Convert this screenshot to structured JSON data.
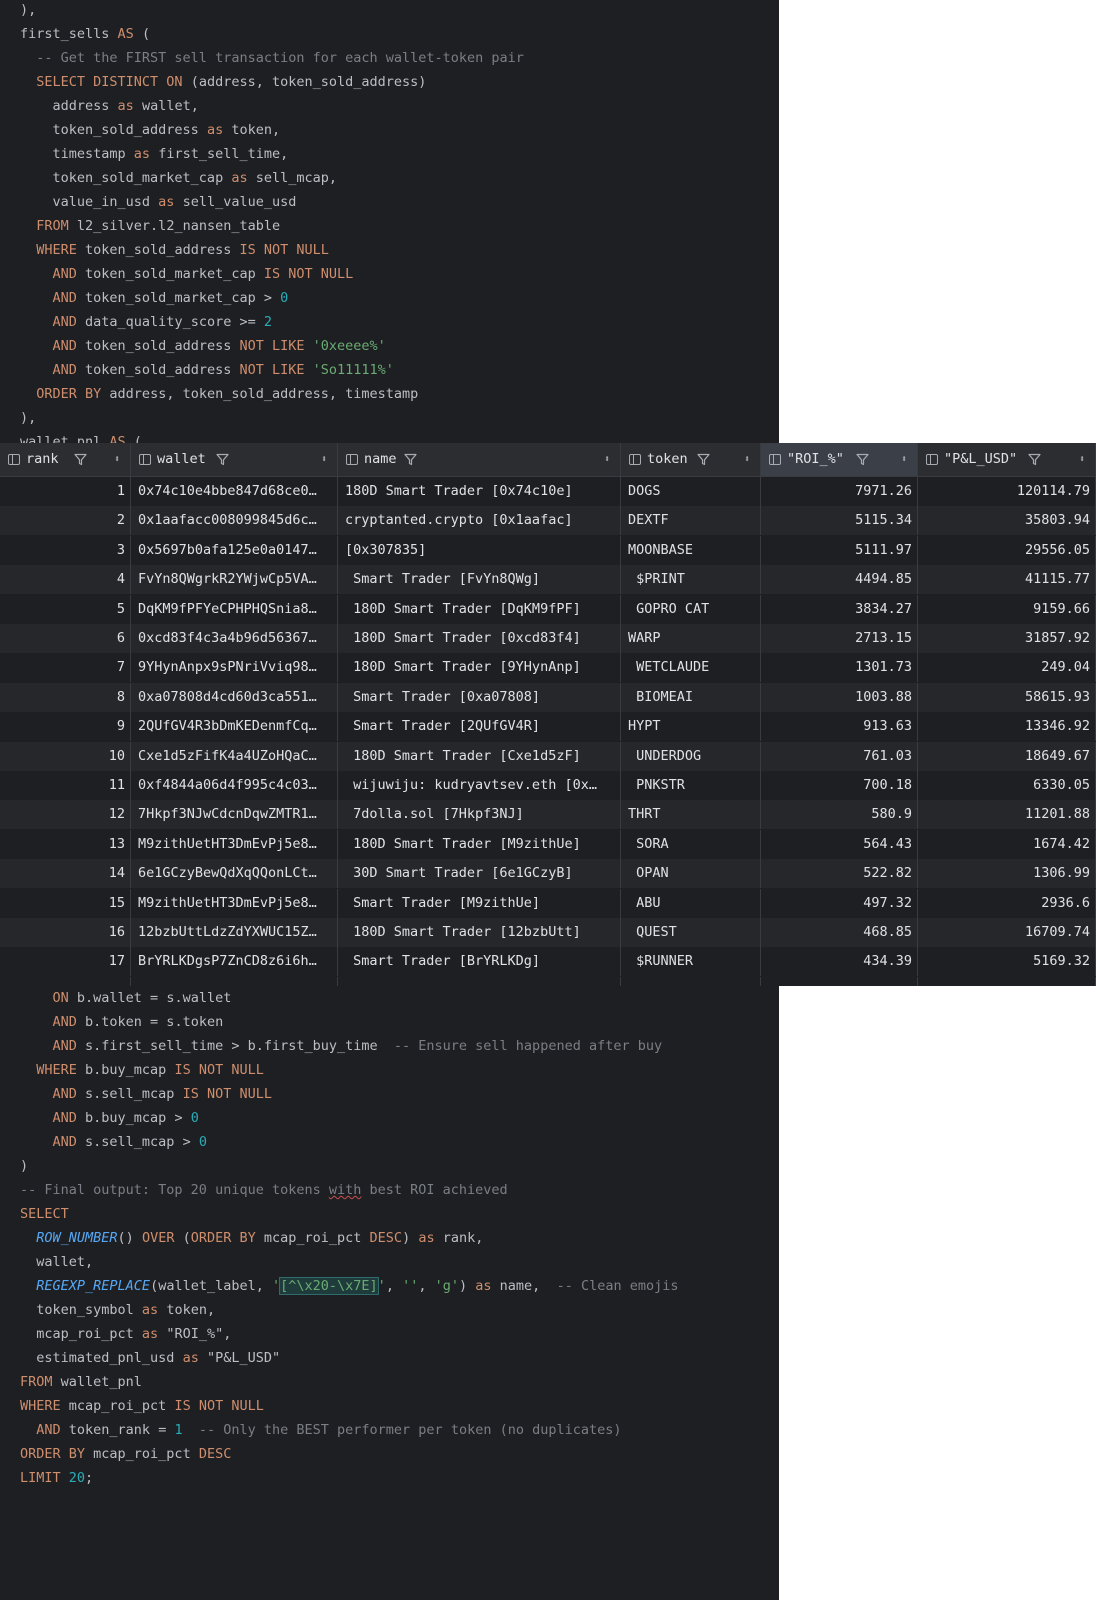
{
  "editor_top": [
    [
      {
        "t": "),",
        "c": ""
      }
    ],
    [
      {
        "t": "first_sells ",
        "c": ""
      },
      {
        "t": "AS",
        "c": "kw"
      },
      {
        "t": " (",
        "c": ""
      }
    ],
    [
      {
        "t": "  -- Get the FIRST sell transaction for each wallet-token pair",
        "c": "cm"
      }
    ],
    [
      {
        "t": "  ",
        "c": ""
      },
      {
        "t": "SELECT DISTINCT ON",
        "c": "kw"
      },
      {
        "t": " (address, token_sold_address)",
        "c": ""
      }
    ],
    [
      {
        "t": "    address ",
        "c": ""
      },
      {
        "t": "as",
        "c": "kw"
      },
      {
        "t": " wallet,",
        "c": ""
      }
    ],
    [
      {
        "t": "    token_sold_address ",
        "c": ""
      },
      {
        "t": "as",
        "c": "kw"
      },
      {
        "t": " token,",
        "c": ""
      }
    ],
    [
      {
        "t": "    timestamp ",
        "c": ""
      },
      {
        "t": "as",
        "c": "kw"
      },
      {
        "t": " first_sell_time,",
        "c": ""
      }
    ],
    [
      {
        "t": "    token_sold_market_cap ",
        "c": ""
      },
      {
        "t": "as",
        "c": "kw"
      },
      {
        "t": " sell_mcap,",
        "c": ""
      }
    ],
    [
      {
        "t": "    value_in_usd ",
        "c": ""
      },
      {
        "t": "as",
        "c": "kw"
      },
      {
        "t": " sell_value_usd",
        "c": ""
      }
    ],
    [
      {
        "t": "  ",
        "c": ""
      },
      {
        "t": "FROM",
        "c": "kw"
      },
      {
        "t": " l2_silver.l2_nansen_table",
        "c": ""
      }
    ],
    [
      {
        "t": "  ",
        "c": ""
      },
      {
        "t": "WHERE",
        "c": "kw"
      },
      {
        "t": " token_sold_address ",
        "c": ""
      },
      {
        "t": "IS NOT NULL",
        "c": "kw"
      }
    ],
    [
      {
        "t": "    ",
        "c": ""
      },
      {
        "t": "AND",
        "c": "kw"
      },
      {
        "t": " token_sold_market_cap ",
        "c": ""
      },
      {
        "t": "IS NOT NULL",
        "c": "kw"
      }
    ],
    [
      {
        "t": "    ",
        "c": ""
      },
      {
        "t": "AND",
        "c": "kw"
      },
      {
        "t": " token_sold_market_cap > ",
        "c": ""
      },
      {
        "t": "0",
        "c": "num"
      }
    ],
    [
      {
        "t": "    ",
        "c": ""
      },
      {
        "t": "AND",
        "c": "kw"
      },
      {
        "t": " data_quality_score >= ",
        "c": ""
      },
      {
        "t": "2",
        "c": "num"
      }
    ],
    [
      {
        "t": "    ",
        "c": ""
      },
      {
        "t": "AND",
        "c": "kw"
      },
      {
        "t": " token_sold_address ",
        "c": ""
      },
      {
        "t": "NOT LIKE",
        "c": "kw"
      },
      {
        "t": " ",
        "c": ""
      },
      {
        "t": "'0xeeee%'",
        "c": "str"
      }
    ],
    [
      {
        "t": "    ",
        "c": ""
      },
      {
        "t": "AND",
        "c": "kw"
      },
      {
        "t": " token_sold_address ",
        "c": ""
      },
      {
        "t": "NOT LIKE",
        "c": "kw"
      },
      {
        "t": " ",
        "c": ""
      },
      {
        "t": "'So11111%'",
        "c": "str"
      }
    ],
    [
      {
        "t": "  ",
        "c": ""
      },
      {
        "t": "ORDER BY",
        "c": "kw"
      },
      {
        "t": " address, token_sold_address, timestamp",
        "c": ""
      }
    ],
    [
      {
        "t": "),",
        "c": ""
      }
    ],
    [
      {
        "t": "wallet_pnl ",
        "c": ""
      },
      {
        "t": "AS",
        "c": "kw"
      },
      {
        "t": " (",
        "c": ""
      }
    ]
  ],
  "editor_bottom": [
    [
      {
        "t": "    ",
        "c": ""
      },
      {
        "t": "ON",
        "c": "kw"
      },
      {
        "t": " b.wallet = s.wallet",
        "c": ""
      }
    ],
    [
      {
        "t": "    ",
        "c": ""
      },
      {
        "t": "AND",
        "c": "kw"
      },
      {
        "t": " b.token = s.token",
        "c": ""
      }
    ],
    [
      {
        "t": "    ",
        "c": ""
      },
      {
        "t": "AND",
        "c": "kw"
      },
      {
        "t": " s.first_sell_time > b.first_buy_time  ",
        "c": ""
      },
      {
        "t": "-- Ensure sell happened after buy",
        "c": "cm"
      }
    ],
    [
      {
        "t": "  ",
        "c": ""
      },
      {
        "t": "WHERE",
        "c": "kw"
      },
      {
        "t": " b.buy_mcap ",
        "c": ""
      },
      {
        "t": "IS NOT NULL",
        "c": "kw"
      }
    ],
    [
      {
        "t": "    ",
        "c": ""
      },
      {
        "t": "AND",
        "c": "kw"
      },
      {
        "t": " s.sell_mcap ",
        "c": ""
      },
      {
        "t": "IS NOT NULL",
        "c": "kw"
      }
    ],
    [
      {
        "t": "    ",
        "c": ""
      },
      {
        "t": "AND",
        "c": "kw"
      },
      {
        "t": " b.buy_mcap > ",
        "c": ""
      },
      {
        "t": "0",
        "c": "num"
      }
    ],
    [
      {
        "t": "    ",
        "c": ""
      },
      {
        "t": "AND",
        "c": "kw"
      },
      {
        "t": " s.sell_mcap > ",
        "c": ""
      },
      {
        "t": "0",
        "c": "num"
      }
    ],
    [
      {
        "t": ")",
        "c": ""
      }
    ],
    [
      {
        "t": "-- Final output: Top 20 unique tokens ",
        "c": "cm"
      },
      {
        "t": "with",
        "c": "cm squig"
      },
      {
        "t": " best ROI achieved",
        "c": "cm"
      }
    ],
    [
      {
        "t": "SELECT",
        "c": "kw"
      }
    ],
    [
      {
        "t": "  ",
        "c": ""
      },
      {
        "t": "ROW_NUMBER",
        "c": "fn"
      },
      {
        "t": "() ",
        "c": ""
      },
      {
        "t": "OVER",
        "c": "kw"
      },
      {
        "t": " (",
        "c": ""
      },
      {
        "t": "ORDER BY",
        "c": "kw"
      },
      {
        "t": " mcap_roi_pct ",
        "c": ""
      },
      {
        "t": "DESC",
        "c": "kw"
      },
      {
        "t": ") ",
        "c": ""
      },
      {
        "t": "as",
        "c": "kw"
      },
      {
        "t": " rank,",
        "c": ""
      }
    ],
    [
      {
        "t": "  wallet,",
        "c": ""
      }
    ],
    [
      {
        "t": "  ",
        "c": ""
      },
      {
        "t": "REGEXP_REPLACE",
        "c": "fn"
      },
      {
        "t": "(wallet_label, ",
        "c": ""
      },
      {
        "t": "'",
        "c": "str"
      },
      {
        "t": "[^\\x20-\\x7E]",
        "c": "rx"
      },
      {
        "t": "'",
        "c": "str"
      },
      {
        "t": ", ",
        "c": ""
      },
      {
        "t": "''",
        "c": "str"
      },
      {
        "t": ", ",
        "c": ""
      },
      {
        "t": "'g'",
        "c": "str"
      },
      {
        "t": ") ",
        "c": ""
      },
      {
        "t": "as",
        "c": "kw"
      },
      {
        "t": " name,  ",
        "c": ""
      },
      {
        "t": "-- Clean emojis",
        "c": "cm"
      }
    ],
    [
      {
        "t": "  token_symbol ",
        "c": ""
      },
      {
        "t": "as",
        "c": "kw"
      },
      {
        "t": " token,",
        "c": ""
      }
    ],
    [
      {
        "t": "  mcap_roi_pct ",
        "c": ""
      },
      {
        "t": "as",
        "c": "kw"
      },
      {
        "t": " \"ROI_%\",",
        "c": ""
      }
    ],
    [
      {
        "t": "  estimated_pnl_usd ",
        "c": ""
      },
      {
        "t": "as",
        "c": "kw"
      },
      {
        "t": " \"P&L_USD\"",
        "c": ""
      }
    ],
    [
      {
        "t": "FROM",
        "c": "kw"
      },
      {
        "t": " wallet_pnl",
        "c": ""
      }
    ],
    [
      {
        "t": "WHERE",
        "c": "kw"
      },
      {
        "t": " mcap_roi_pct ",
        "c": ""
      },
      {
        "t": "IS NOT NULL",
        "c": "kw"
      }
    ],
    [
      {
        "t": "  ",
        "c": ""
      },
      {
        "t": "AND",
        "c": "kw"
      },
      {
        "t": " token_rank = ",
        "c": ""
      },
      {
        "t": "1",
        "c": "num"
      },
      {
        "t": "  ",
        "c": ""
      },
      {
        "t": "-- Only the BEST performer per token (no duplicates)",
        "c": "cm"
      }
    ],
    [
      {
        "t": "ORDER BY",
        "c": "kw"
      },
      {
        "t": " mcap_roi_pct ",
        "c": ""
      },
      {
        "t": "DESC",
        "c": "kw"
      }
    ],
    [
      {
        "t": "LIMIT",
        "c": "kw"
      },
      {
        "t": " ",
        "c": ""
      },
      {
        "t": "20",
        "c": "num"
      },
      {
        "t": ";",
        "c": ""
      }
    ]
  ],
  "grid": {
    "columns": [
      "rank",
      "wallet",
      "name",
      "token",
      "\"ROI_%\"",
      "\"P&L_USD\""
    ],
    "rows": [
      [
        "1",
        "0x74c10e4bbe847d68ce0…",
        "180D Smart Trader [0x74c10e]",
        "DOGS",
        "7971.26",
        "120114.79"
      ],
      [
        "2",
        "0x1aafacc008099845d6c…",
        "cryptanted.crypto [0x1aafac]",
        "DEXTF",
        "5115.34",
        "35803.94"
      ],
      [
        "3",
        "0x5697b0afa125e0a0147…",
        "[0x307835]",
        "MOONBASE",
        "5111.97",
        "29556.05"
      ],
      [
        "4",
        "FvYn8QWgrkR2YWjwCp5VA…",
        " Smart Trader [FvYn8QWg]",
        " $PRINT",
        "4494.85",
        "41115.77"
      ],
      [
        "5",
        "DqKM9fPFYeCPHPHQSnia8…",
        " 180D Smart Trader [DqKM9fPF]",
        " GOPRO CAT",
        "3834.27",
        "9159.66"
      ],
      [
        "6",
        "0xcd83f4c3a4b96d56367…",
        " 180D Smart Trader [0xcd83f4]",
        "WARP",
        "2713.15",
        "31857.92"
      ],
      [
        "7",
        "9YHynAnpx9sPNriVviq98…",
        " 180D Smart Trader [9YHynAnp]",
        " WETCLAUDE",
        "1301.73",
        "249.04"
      ],
      [
        "8",
        "0xa07808d4cd60d3ca551…",
        " Smart Trader [0xa07808]",
        " BIOMEAI",
        "1003.88",
        "58615.93"
      ],
      [
        "9",
        "2QUfGV4R3bDmKEDenmfCq…",
        " Smart Trader [2QUfGV4R]",
        "HYPT",
        "913.63",
        "13346.92"
      ],
      [
        "10",
        "Cxe1d5zFifK4a4UZoHQaC…",
        " 180D Smart Trader [Cxe1d5zF]",
        " UNDERDOG",
        "761.03",
        "18649.67"
      ],
      [
        "11",
        "0xf4844a06d4f995c4c03…",
        " wijuwiju: kudryavtsev.eth [0x…",
        " PNKSTR",
        "700.18",
        "6330.05"
      ],
      [
        "12",
        "7Hkpf3NJwCdcnDqwZMTR1…",
        " 7dolla.sol [7Hkpf3NJ]",
        "THRT",
        "580.9",
        "11201.88"
      ],
      [
        "13",
        "M9zithUetHT3DmEvPj5e8…",
        " 180D Smart Trader [M9zithUe]",
        " SORA",
        "564.43",
        "1674.42"
      ],
      [
        "14",
        "6e1GCzyBewQdXqQQonLCt…",
        " 30D Smart Trader [6e1GCzyB]",
        " OPAN",
        "522.82",
        "1306.99"
      ],
      [
        "15",
        "M9zithUetHT3DmEvPj5e8…",
        " Smart Trader [M9zithUe]",
        " ABU",
        "497.32",
        "2936.6"
      ],
      [
        "16",
        "12bzbUttLdzZdYXWUC15Z…",
        " 180D Smart Trader [12bzbUtt]",
        " QUEST",
        "468.85",
        "16709.74"
      ],
      [
        "17",
        "BrYRLKDgsP7ZnCD8z6i6h…",
        " Smart Trader [BrYRLKDg]",
        " $RUNNER",
        "434.39",
        "5169.32"
      ]
    ]
  },
  "icons": {
    "column": "column-icon",
    "filter": "funnel-filter-icon",
    "sort": "sort-arrows-icon"
  },
  "colors": {
    "editor_bg": "#1e1f22",
    "keyword": "#cf8e6d",
    "comment": "#7a7e85",
    "number": "#2aacb8",
    "string": "#6aab73",
    "function": "#56a8f5",
    "active_header": "#3b3f48"
  }
}
